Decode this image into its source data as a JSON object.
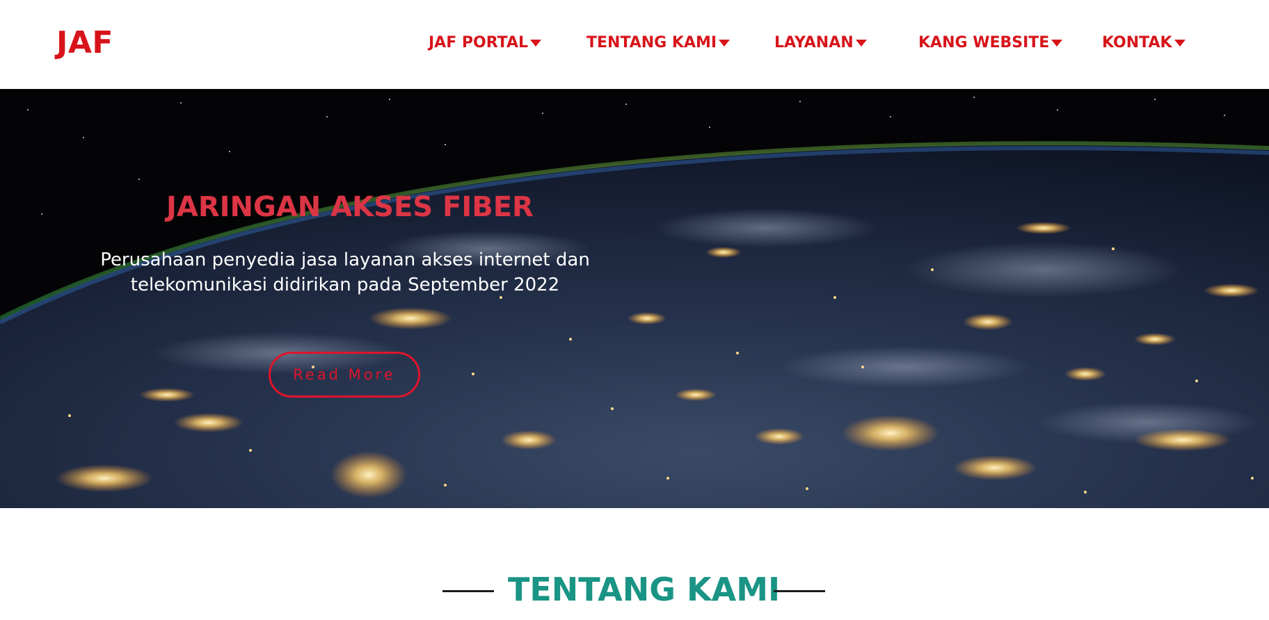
{
  "header": {
    "logo": "JAF",
    "nav": [
      {
        "label": "JAF PORTAL"
      },
      {
        "label": "TENTANG KAMI"
      },
      {
        "label": "LAYANAN"
      },
      {
        "label": "KANG WEBSITE"
      },
      {
        "label": "KONTAK"
      }
    ]
  },
  "hero": {
    "title": "JARINGAN AKSES FIBER",
    "subtitle": "Perusahaan penyedia jasa layanan akses internet dan telekomunikasi didirikan pada September 2022",
    "button_label": "Read More"
  },
  "section": {
    "title": "TENTANG KAMI"
  },
  "colors": {
    "brand_red": "#d7141a",
    "teal": "#1a9485",
    "hero_title": "#dc3545"
  }
}
